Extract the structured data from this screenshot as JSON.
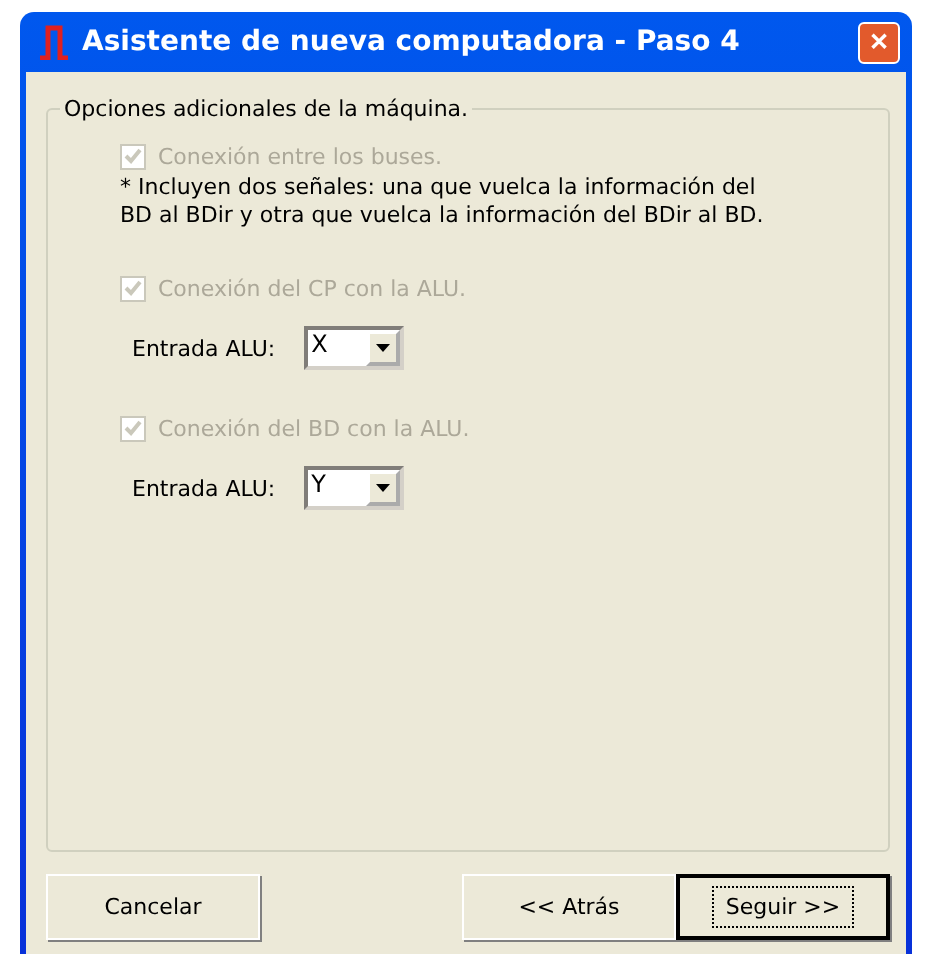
{
  "window": {
    "title": "Asistente de nueva computadora - Paso 4",
    "close": "✕"
  },
  "group": {
    "legend": "Opciones adicionales de la máquina.",
    "options": [
      {
        "kind": "note",
        "label": "Conexión entre los buses.",
        "checked": true,
        "disabled": true,
        "note": "* Incluyen dos señales: una que vuelca la información del\nBD al BDir y otra que vuelca la información del BDir al BD."
      },
      {
        "kind": "select",
        "label": "Conexión del CP con la ALU.",
        "checked": true,
        "disabled": true,
        "field_label": "Entrada ALU:",
        "value": "X"
      },
      {
        "kind": "select",
        "label": "Conexión del BD con la ALU.",
        "checked": true,
        "disabled": true,
        "field_label": "Entrada ALU:",
        "value": "Y"
      }
    ]
  },
  "buttons": [
    {
      "label": "Cancelar",
      "default": false
    },
    {
      "label": "<< Atrás",
      "default": false
    },
    {
      "label": "Seguir >>",
      "default": true
    }
  ]
}
